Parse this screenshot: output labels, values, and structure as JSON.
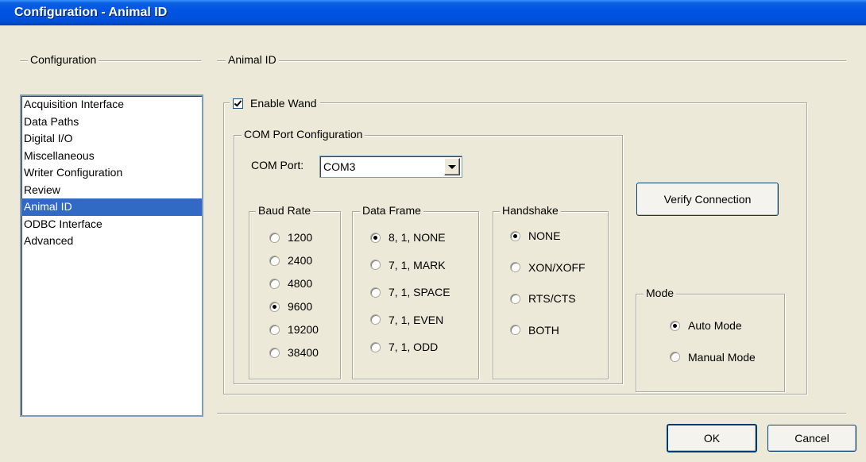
{
  "window": {
    "title": "Configuration - Animal ID"
  },
  "left_group": {
    "label": "Configuration"
  },
  "right_group": {
    "label": "Animal ID"
  },
  "nav": {
    "items": [
      "Acquisition Interface",
      "Data Paths",
      "Digital I/O",
      "Miscellaneous",
      "Writer Configuration",
      "Review",
      "Animal ID",
      "ODBC Interface",
      "Advanced"
    ],
    "selected": "Animal ID"
  },
  "wand": {
    "label": "Enable Wand",
    "checked": true
  },
  "com_port_config": {
    "label": "COM Port Configuration",
    "com_port_label": "COM Port:",
    "com_port_value": "COM3"
  },
  "baud_rate": {
    "label": "Baud Rate",
    "options": [
      "1200",
      "2400",
      "4800",
      "9600",
      "19200",
      "38400"
    ],
    "selected": "9600"
  },
  "data_frame": {
    "label": "Data Frame",
    "options": [
      "8, 1, NONE",
      "7, 1, MARK",
      "7, 1, SPACE",
      "7, 1, EVEN",
      "7, 1, ODD"
    ],
    "selected": "8, 1, NONE"
  },
  "handshake": {
    "label": "Handshake",
    "options": [
      "NONE",
      "XON/XOFF",
      "RTS/CTS",
      "BOTH"
    ],
    "selected": "NONE"
  },
  "verify_button": {
    "label": "Verify Connection"
  },
  "mode": {
    "label": "Mode",
    "options": [
      "Auto Mode",
      "Manual Mode"
    ],
    "selected": "Auto Mode"
  },
  "footer": {
    "ok_label": "OK",
    "cancel_label": "Cancel"
  }
}
